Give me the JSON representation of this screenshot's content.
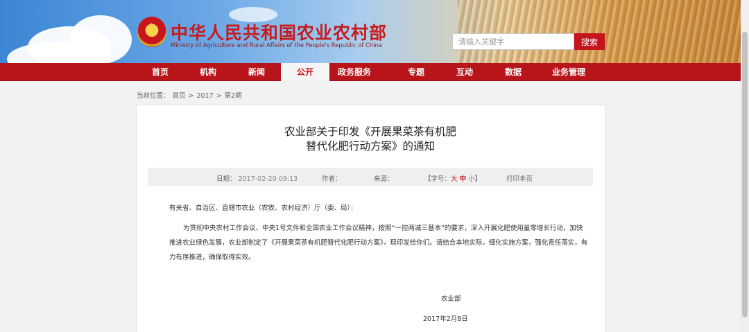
{
  "header": {
    "title": "中华人民共和国农业农村部",
    "subtitle": "Ministry of Agriculture and Rural Affairs of the People's Republic of China",
    "search_placeholder": "请输入关键字",
    "search_button": "搜索"
  },
  "nav": {
    "items": [
      {
        "label": "首页"
      },
      {
        "label": "机构"
      },
      {
        "label": "新闻"
      },
      {
        "label": "公开",
        "active": true
      },
      {
        "label": "政务服务"
      },
      {
        "label": "专题"
      },
      {
        "label": "互动"
      },
      {
        "label": "数据"
      },
      {
        "label": "业务管理"
      }
    ]
  },
  "breadcrumb": {
    "prefix": "当前位置：",
    "items": [
      "首页",
      "2017",
      "第2期"
    ],
    "separator": ">"
  },
  "article": {
    "title_line1": "农业部关于印发《开展果菜茶有机肥",
    "title_line2": "替代化肥行动方案》的通知",
    "meta": {
      "date_label": "日期：",
      "date_value": "2017-02-20 09:13",
      "author_label": "作者：",
      "source_label": "来源：",
      "fontsize_prefix": "【字号：",
      "fontsize_large": "大",
      "fontsize_medium": "中",
      "fontsize_small": "小",
      "fontsize_suffix": "】",
      "print_label": "打印本页"
    },
    "salutation": "有关省、自治区、直辖市农业（农牧、农村经济）厅（委、局）：",
    "paragraph_line1": "为贯彻中央农村工作会议、中央1号文件和全国农业工作会议精神，按照“一控两减三基本”的要求，深入开展化肥使用量零增长行动，加快",
    "paragraph_line2": "推进农业绿色发展，农业部制定了《开展果菜茶有机肥替代化肥行动方案》，现印发给你们。请结合本地实际，细化实施方案，强化责任落实，有",
    "paragraph_line3": "力有序推进，确保取得实效。",
    "signature": "农业部",
    "sign_date": "2017年2月8日"
  },
  "colors": {
    "brand_red": "#c4151c",
    "nav_red": "#b8151b",
    "title_red": "#c81a1a"
  },
  "icons": {
    "emblem": "national-emblem-icon"
  }
}
